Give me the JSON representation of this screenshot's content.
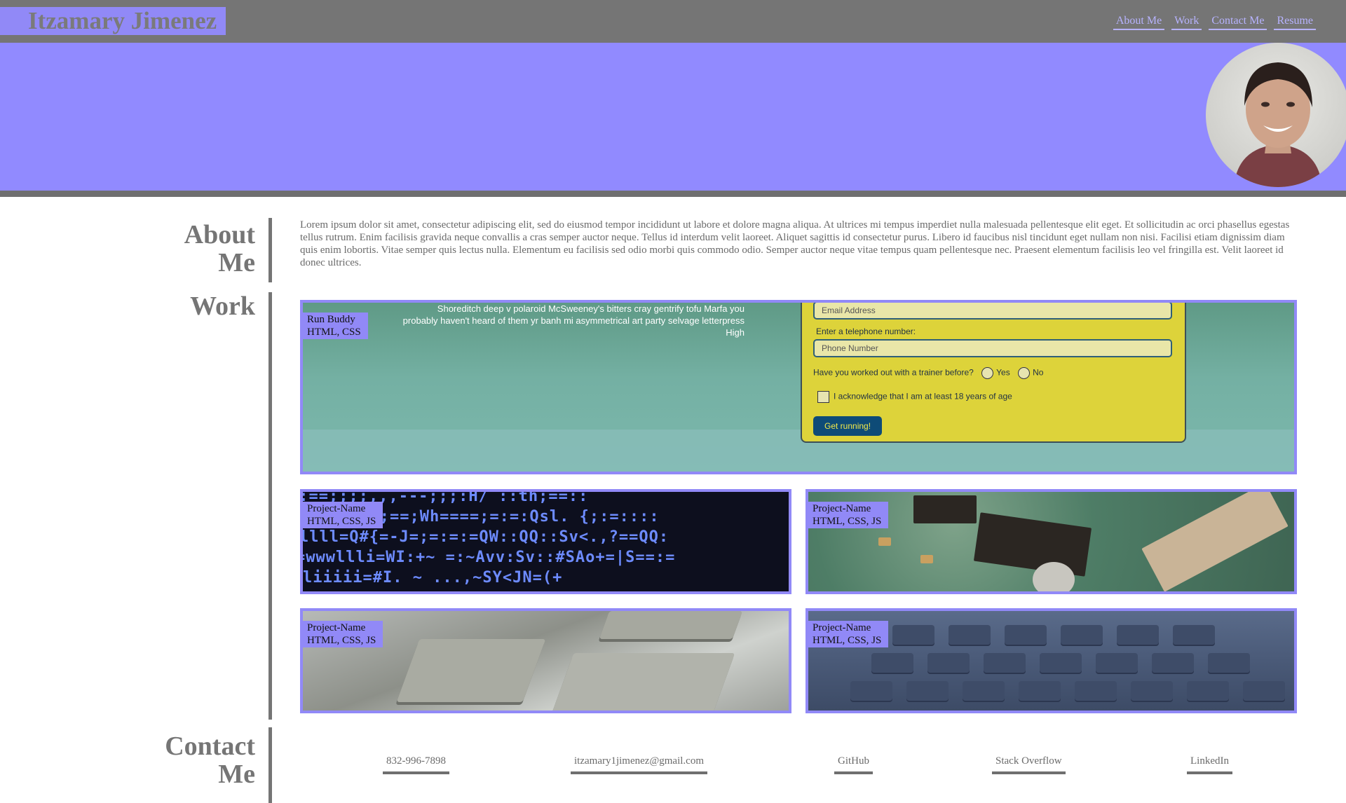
{
  "header": {
    "name": "Itzamary Jimenez",
    "nav": [
      "About Me",
      "Work",
      "Contact Me",
      "Resume"
    ]
  },
  "hero": {
    "avatar": "profile-photo"
  },
  "about": {
    "title": "About Me",
    "text": "Lorem ipsum dolor sit amet, consectetur adipiscing elit, sed do eiusmod tempor incididunt ut labore et dolore magna aliqua. At ultrices mi tempus imperdiet nulla malesuada pellentesque elit eget. Et sollicitudin ac orci phasellus egestas tellus rutrum. Enim facilisis gravida neque convallis a cras semper auctor neque. Tellus id interdum velit laoreet. Aliquet sagittis id consectetur purus. Libero id faucibus nisl tincidunt eget nullam non nisi. Facilisi etiam dignissim diam quis enim lobortis. Vitae semper quis lectus nulla. Elementum eu facilisis sed odio morbi quis commodo odio. Semper auctor neque vitae tempus quam pellentesque nec. Praesent elementum facilisis leo vel fringilla est. Velit laoreet id donec ultrices."
  },
  "work": {
    "title": "Work",
    "featured": {
      "name": "Run Buddy",
      "tech": "HTML, CSS",
      "screenshot": {
        "tagline": "Shoreditch deep v polaroid McSweeney's bitters cray gentrify tofu Marfa you probably haven't heard of them yr banh mi asymmetrical art party selvage letterpress High",
        "email_placeholder": "Email Address",
        "phone_label": "Enter a telephone number:",
        "phone_placeholder": "Phone Number",
        "trainer_question": "Have you worked out with a trainer before?",
        "yes": "Yes",
        "no": "No",
        "age_ack": "I acknowledge that I am at least 18 years of age",
        "button": "Get running!"
      }
    },
    "projects": [
      {
        "name": "Project-Name",
        "tech": "HTML, CSS, JS"
      },
      {
        "name": "Project-Name",
        "tech": "HTML, CSS, JS"
      },
      {
        "name": "Project-Name",
        "tech": "HTML, CSS, JS"
      },
      {
        "name": "Project-Name",
        "tech": "HTML, CSS, JS"
      }
    ],
    "code_lines": [
      "-:==;;;;,,,---;;;:H/ ::th;==::",
      "vnll::=;==;Wh====;=:=:Qsl. {;:=::::",
      "llll=Q#{=-J=;=:=:=QW::QQ::Sv<.,?==QQ:",
      "=wwwllli=WI:+~ =:~Avv:Sv::#SAo+=|S==:=",
      "liiiii=#I. ~ ...,~SY<JN=(+"
    ]
  },
  "contact": {
    "title": "Contact Me",
    "links": [
      "832-996-7898",
      "itzamary1jimenez@gmail.com",
      "GitHub",
      "Stack Overflow",
      "LinkedIn"
    ]
  },
  "colors": {
    "accent": "#9189f7",
    "header_gray": "#757575",
    "text_gray": "#6a6a6a"
  }
}
